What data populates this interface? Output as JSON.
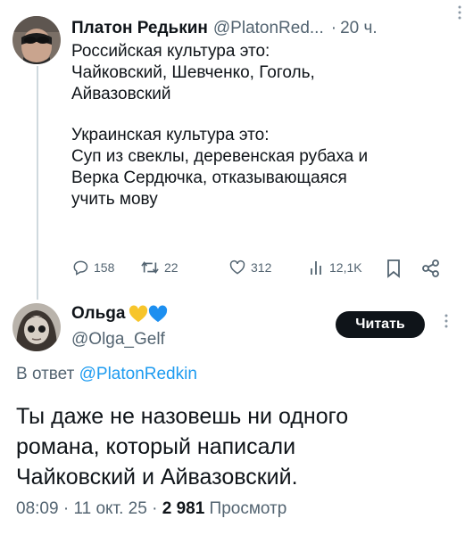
{
  "tweet1": {
    "author_name": "Платон Редькин",
    "author_handle": "@PlatonRed...",
    "separator": "·",
    "time": "20 ч.",
    "text_lines": [
      "Российская культура это:",
      "Чайковский, Шевченко, Гоголь,",
      "Айвазовский",
      "Украинская культура это:",
      "Суп из свеклы, деревенская рубаха и",
      "Верка Сердючка, отказывающаяся",
      "учить мову"
    ],
    "replies": "158",
    "reposts": "22",
    "likes": "312",
    "views": "12,1K"
  },
  "tweet2": {
    "author_name": "Ольga",
    "author_handle": "@Olga_Gelf",
    "follow_label": "Читать",
    "reply_prefix": "В ответ",
    "reply_mention": "@PlatonRedkin",
    "text_lines": [
      "Ты даже не назовешь ни одного",
      "романа, который написали",
      "Чайковский и Айвазовский."
    ],
    "time": "08:09",
    "date": "11 окт. 25",
    "view_count": "2 981",
    "view_label": "Просмотр",
    "heart_colors": [
      "#f7c52b",
      "#1d8ff0"
    ]
  },
  "icons": [
    "more-icon",
    "reply-icon",
    "repost-icon",
    "like-icon",
    "views-icon",
    "bookmark-icon",
    "share-icon",
    "heart-yellow-icon",
    "heart-blue-icon"
  ]
}
